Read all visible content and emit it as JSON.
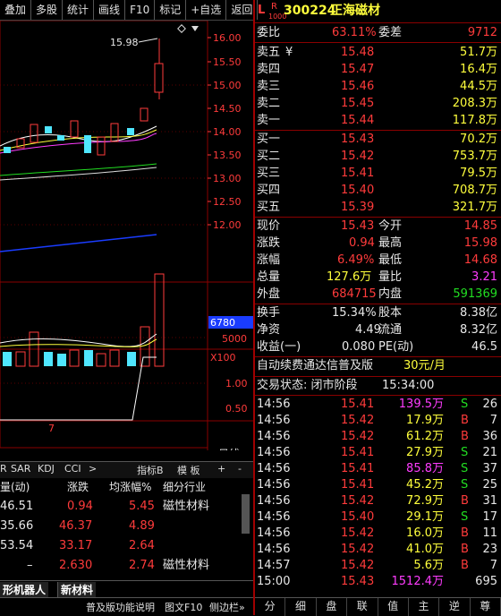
{
  "toolbar": [
    "叠加",
    "多股",
    "统计",
    "画线",
    "F10",
    "标记",
    "+自选",
    "返回"
  ],
  "header": {
    "l_label": "L",
    "r_label": "R",
    "r_sub": "1000",
    "code": "300224",
    "name": "正海磁材"
  },
  "commission": {
    "ratio_label": "委比",
    "ratio": "63.11%",
    "diff_label": "委差",
    "diff": "9712"
  },
  "asks": [
    {
      "label": "卖五",
      "mark": "¥",
      "price": "15.48",
      "vol": "51.7万"
    },
    {
      "label": "卖四",
      "mark": "",
      "price": "15.47",
      "vol": "16.4万"
    },
    {
      "label": "卖三",
      "mark": "",
      "price": "15.46",
      "vol": "44.5万"
    },
    {
      "label": "卖二",
      "mark": "",
      "price": "15.45",
      "vol": "208.3万"
    },
    {
      "label": "卖一",
      "mark": "",
      "price": "15.44",
      "vol": "117.8万"
    }
  ],
  "bids": [
    {
      "label": "买一",
      "price": "15.43",
      "vol": "70.2万"
    },
    {
      "label": "买二",
      "price": "15.42",
      "vol": "753.7万"
    },
    {
      "label": "买三",
      "price": "15.41",
      "vol": "79.5万"
    },
    {
      "label": "买四",
      "price": "15.40",
      "vol": "708.7万"
    },
    {
      "label": "买五",
      "price": "15.39",
      "vol": "321.7万"
    }
  ],
  "quote": [
    {
      "l1": "现价",
      "v1": "15.43",
      "c1": "red",
      "l2": "今开",
      "v2": "14.85",
      "c2": "red"
    },
    {
      "l1": "涨跌",
      "v1": "0.94",
      "c1": "red",
      "l2": "最高",
      "v2": "15.98",
      "c2": "red"
    },
    {
      "l1": "涨幅",
      "v1": "6.49%",
      "c1": "red",
      "l2": "最低",
      "v2": "14.68",
      "c2": "red"
    },
    {
      "l1": "总量",
      "v1": "127.6万",
      "c1": "yel",
      "l2": "量比",
      "v2": "3.21",
      "c2": "mag"
    },
    {
      "l1": "外盘",
      "v1": "684715",
      "c1": "red",
      "l2": "内盘",
      "v2": "591369",
      "c2": "green"
    }
  ],
  "stats": [
    {
      "l1": "换手",
      "v1": "15.34%",
      "l2": "股本",
      "v2": "8.38亿"
    },
    {
      "l1": "净资",
      "v1": "4.49",
      "l2": "流通",
      "v2": "8.32亿"
    },
    {
      "l1": "收益(一)",
      "v1": "0.080",
      "l2": "PE(动)",
      "v2": "46.5"
    }
  ],
  "promo": {
    "text": "自动续费通达信普及版",
    "price": "30元/月"
  },
  "trade_status": {
    "label": "交易状态: 闭市阶段",
    "time": "15:34:00"
  },
  "ticks": [
    {
      "t": "14:56",
      "p": "15.41",
      "v": "139.5万",
      "vc": "mag",
      "d": "S",
      "n": "26"
    },
    {
      "t": "14:56",
      "p": "15.42",
      "v": "17.9万",
      "vc": "yel",
      "d": "B",
      "n": "7"
    },
    {
      "t": "14:56",
      "p": "15.42",
      "v": "61.2万",
      "vc": "yel",
      "d": "B",
      "n": "36"
    },
    {
      "t": "14:56",
      "p": "15.41",
      "v": "27.9万",
      "vc": "yel",
      "d": "S",
      "n": "21"
    },
    {
      "t": "14:56",
      "p": "15.41",
      "v": "85.8万",
      "vc": "mag",
      "d": "S",
      "n": "37"
    },
    {
      "t": "14:56",
      "p": "15.41",
      "v": "45.2万",
      "vc": "yel",
      "d": "S",
      "n": "25"
    },
    {
      "t": "14:56",
      "p": "15.42",
      "v": "72.9万",
      "vc": "yel",
      "d": "B",
      "n": "31"
    },
    {
      "t": "14:56",
      "p": "15.40",
      "v": "29.1万",
      "vc": "yel",
      "d": "S",
      "n": "17"
    },
    {
      "t": "14:56",
      "p": "15.42",
      "v": "16.0万",
      "vc": "yel",
      "d": "B",
      "n": "11"
    },
    {
      "t": "14:56",
      "p": "15.42",
      "v": "41.0万",
      "vc": "yel",
      "d": "B",
      "n": "23"
    },
    {
      "t": "14:57",
      "p": "15.42",
      "v": "5.6万",
      "vc": "yel",
      "d": "B",
      "n": "7"
    },
    {
      "t": "15:00",
      "p": "15.43",
      "v": "1512.4万",
      "vc": "mag",
      "d": "",
      "n": "695"
    }
  ],
  "chart": {
    "price_axis": [
      "16.00",
      "15.50",
      "15.00",
      "14.50",
      "14.00",
      "13.50",
      "13.00",
      "12.50",
      "12.00"
    ],
    "peak_label": "15.98",
    "vol_axis": [
      "6780",
      "5000",
      "X100"
    ],
    "ind_axis": [
      "1.00",
      "0.50"
    ],
    "x_label": "7",
    "bottom_right": "日线"
  },
  "indicator_tabs": [
    "R",
    "SAR",
    "KDJ",
    "CCI",
    ">",
    "指标B",
    "模 板",
    "+",
    "-"
  ],
  "table": {
    "headers": [
      "量(动)",
      "涨跌",
      "均涨幅%",
      "细分行业"
    ],
    "rows": [
      {
        "a": "46.51",
        "b": "0.94",
        "c": "5.45",
        "d": "磁性材料"
      },
      {
        "a": "35.66",
        "b": "46.37",
        "c": "4.89",
        "d": ""
      },
      {
        "a": "53.54",
        "b": "33.17",
        "c": "2.64",
        "d": ""
      },
      {
        "a": "–",
        "b": "2.630",
        "c": "2.74",
        "d": "磁性材料"
      }
    ]
  },
  "bottom_tabs": [
    "形机器人",
    "新材料"
  ],
  "bottom_bar": [
    "普及版功能说明",
    "图文F10",
    "侧边栏»"
  ],
  "right_bottom": [
    "分",
    "细",
    "盘",
    "联",
    "值",
    "主",
    "逆",
    "尊"
  ]
}
